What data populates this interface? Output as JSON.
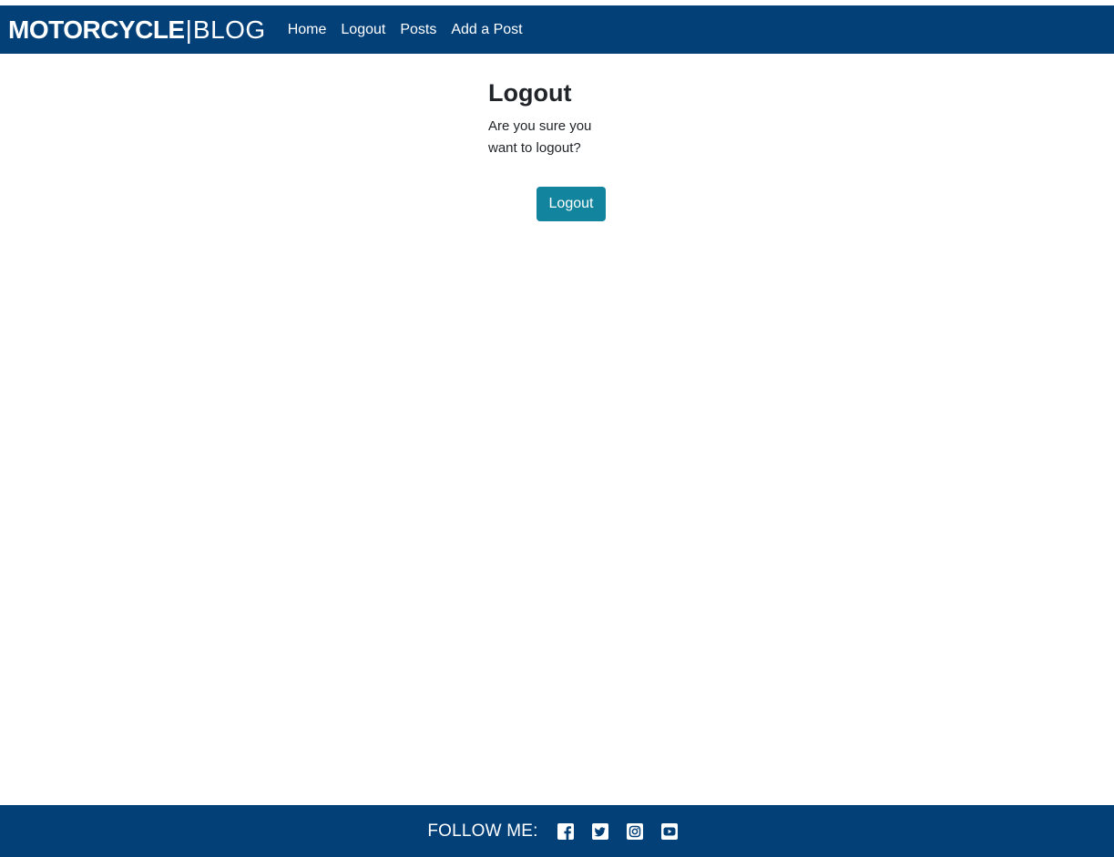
{
  "navbar": {
    "brand_bold": "MOTORCYCLE",
    "brand_separator": "|",
    "brand_light": "BLOG",
    "links": [
      "Home",
      "Logout",
      "Posts",
      "Add a Post"
    ]
  },
  "main": {
    "heading": "Logout",
    "message": "Are you sure you want to logout?",
    "button_label": "Logout"
  },
  "footer": {
    "follow_label": "FOLLOW ME:",
    "social_icons": [
      "facebook-icon",
      "twitter-icon",
      "instagram-icon",
      "youtube-icon"
    ]
  },
  "colors": {
    "navbar_bg": "#034078",
    "button_bg": "#13849e",
    "text": "#212529"
  }
}
